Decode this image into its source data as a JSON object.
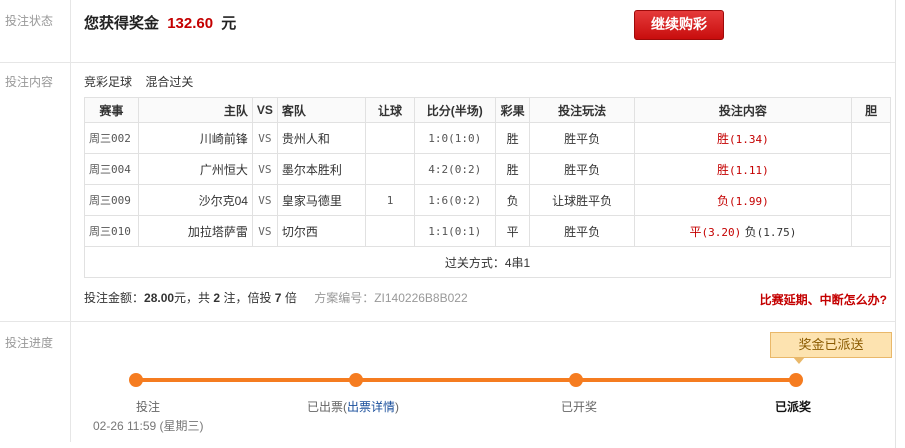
{
  "status": {
    "side_label": "投注状态",
    "prize_prefix": "您获得奖金",
    "prize_amount": "132.60",
    "prize_unit": "元",
    "continue_button": "继续购彩"
  },
  "content": {
    "side_label": "投注内容",
    "game_type": "竞彩足球",
    "pass_type": "混合过关",
    "table": {
      "headers": [
        "赛事",
        "主队",
        "VS",
        "客队",
        "让球",
        "比分(半场)",
        "彩果",
        "投注玩法",
        "投注内容",
        "胆"
      ],
      "rows": [
        {
          "id": "周三002",
          "home": "川崎前锋",
          "vs": "VS",
          "away": "贵州人和",
          "handicap": "",
          "score": "1:0(1:0)",
          "result": "胜",
          "play": "胜平负",
          "picks": [
            {
              "label": "胜",
              "odds": "(1.34)",
              "hit": true
            }
          ],
          "banker": ""
        },
        {
          "id": "周三004",
          "home": "广州恒大",
          "vs": "VS",
          "away": "墨尔本胜利",
          "handicap": "",
          "score": "4:2(0:2)",
          "result": "胜",
          "play": "胜平负",
          "picks": [
            {
              "label": "胜",
              "odds": "(1.11)",
              "hit": true
            }
          ],
          "banker": ""
        },
        {
          "id": "周三009",
          "home": "沙尔克04",
          "vs": "VS",
          "away": "皇家马德里",
          "handicap": "1",
          "score": "1:6(0:2)",
          "result": "负",
          "play": "让球胜平负",
          "picks": [
            {
              "label": "负",
              "odds": "(1.99)",
              "hit": true
            }
          ],
          "banker": ""
        },
        {
          "id": "周三010",
          "home": "加拉塔萨雷",
          "vs": "VS",
          "away": "切尔西",
          "handicap": "",
          "score": "1:1(0:1)",
          "result": "平",
          "play": "胜平负",
          "picks": [
            {
              "label": "平",
              "odds": "(3.20)",
              "hit": true
            },
            {
              "label": "负",
              "odds": "(1.75)",
              "hit": false
            }
          ],
          "banker": ""
        }
      ],
      "footer": "过关方式：4串1"
    },
    "summary": {
      "amount_label": "投注金额：",
      "amount": "28.00",
      "amount_unit": "元，共",
      "count": "2",
      "count_unit": "注，倍投",
      "multiple": "7",
      "multiple_unit": "倍",
      "scheme_label": "方案编号：",
      "scheme_no": "ZI140226B8B022"
    },
    "delay_link": "比赛延期、中断怎么办?"
  },
  "progress": {
    "side_label": "投注进度",
    "tip": "奖金已派送",
    "steps": [
      {
        "label": "投注"
      },
      {
        "label": "已出票(",
        "link": "出票详情",
        "suffix": ")"
      },
      {
        "label": "已开奖"
      },
      {
        "label": "已派奖"
      }
    ],
    "time": "02-26 11:59 (星期三)"
  },
  "colors": {
    "accent_red": "#c40000",
    "progress_orange": "#f57c20"
  }
}
